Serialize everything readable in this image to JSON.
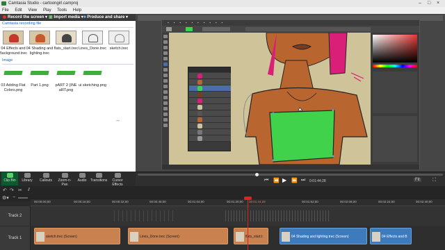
{
  "window": {
    "title": "Camtasia Studio - cartoongirl.camproj",
    "controls": [
      "–",
      "□",
      "×"
    ]
  },
  "menu": [
    "File",
    "Edit",
    "View",
    "Play",
    "Tools",
    "Help"
  ],
  "toolbar": {
    "record": "Record the screen",
    "import": "Import media",
    "produce": "Produce and share"
  },
  "clipbin": {
    "recording_section": "Camtasia recording file",
    "recordings": [
      {
        "name": "04 Effects and Background.trec"
      },
      {
        "name": "04 Shading and lighting.trec"
      },
      {
        "name": "flats_start.trec"
      },
      {
        "name": "Lines_Done.trec"
      },
      {
        "name": "sketch.trec"
      }
    ],
    "image_section": "Image",
    "images": [
      {
        "name": "03 Adding Flat Colors.png"
      },
      {
        "name": "Part 1.png"
      },
      {
        "name": "pART 2 (INE aRT.png"
      },
      {
        "name": "ui sketching.png"
      }
    ]
  },
  "tabs": [
    {
      "label": "Clip Bin",
      "active": true
    },
    {
      "label": "Library",
      "active": false
    },
    {
      "label": "Callouts",
      "active": false
    },
    {
      "label": "Zoom-n-Pan",
      "active": false
    },
    {
      "label": "Audio",
      "active": false
    },
    {
      "label": "Transitions",
      "active": false
    },
    {
      "label": "Cursor Effects",
      "active": false
    }
  ],
  "playback": {
    "time": "0:01:44;28",
    "zoom": "Fit"
  },
  "timeline": {
    "ticks": [
      "00:00:00;00",
      "00:00:16;00",
      "00:00:32;00",
      "00:00:48;00",
      "00:01:04;00",
      "00:01:20;00",
      "00:01:44;28",
      "00:01:52;00",
      "00:02:08;00",
      "00:02:24;00",
      "00:02:40;00"
    ],
    "tracks": [
      {
        "name": "Track 2",
        "clips": []
      },
      {
        "name": "Track 1",
        "clips": [
          {
            "label": "sketch.trec (Screen)",
            "color": "orange"
          },
          {
            "label": "Lines_Done.trec (Screen)",
            "color": "orange"
          },
          {
            "label": "flats_start.t",
            "color": "orange"
          },
          {
            "label": "04 Shading and lighting.trec (Screen)",
            "color": "blue"
          },
          {
            "label": "04 Effects and B",
            "color": "blue"
          }
        ]
      }
    ]
  },
  "photoshop_layers": [
    "Layer 1",
    "Layer 2",
    "Layer 3",
    "Layer 4",
    "Layer 5",
    "Layer 6",
    "Layer 7",
    "Layer 8",
    "Layer 9",
    "Layer 10",
    "Layer 11",
    "Layer 12"
  ],
  "colors": {
    "accent_green": "#0b5b2d",
    "clip_orange": "#c8814f",
    "clip_blue": "#3d7bbd",
    "playhead": "#dd2222",
    "skin": "#b9652f",
    "top": "#3fd24a",
    "hair": "#d91f77"
  }
}
